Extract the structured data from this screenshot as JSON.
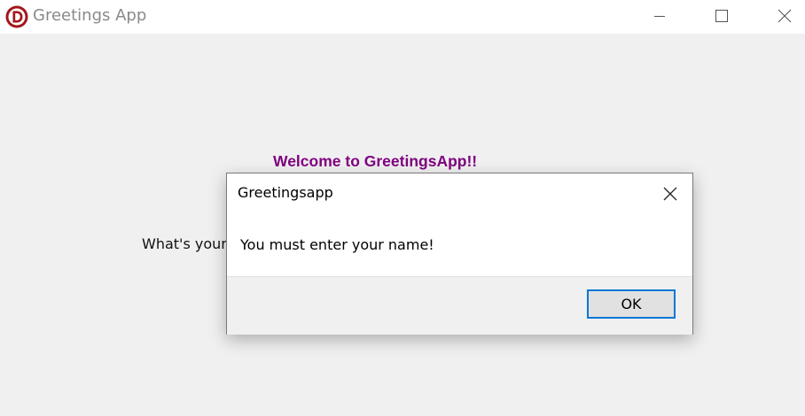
{
  "window": {
    "title": "Greetings App",
    "icon": "app-logo-d-icon"
  },
  "main": {
    "welcome_text": "Welcome to GreetingsApp!!",
    "prompt_text": "What's your",
    "welcome_color": "#800080"
  },
  "dialog": {
    "title": "Greetingsapp",
    "message": "You must enter your name!",
    "ok_label": "OK",
    "accent_color": "#0078d7"
  }
}
